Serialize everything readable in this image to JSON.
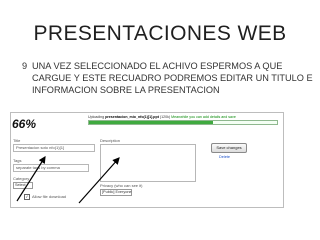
{
  "slide": {
    "title": "PRESENTACIONES WEB",
    "bullet_number": "9",
    "bullet_text": "UNA VEZ SELECCIONADO EL ACHIVO ESPERMOS A QUE CARGUE Y ESTE RECUADRO PODREMOS EDITAR UN TITULO E INFORMACION SOBRE LA PRESENTACION"
  },
  "screenshot": {
    "progress_label": "66%",
    "progress_fraction": 0.66,
    "upload_prefix": "Uploading",
    "upload_filename": "presentacion_mio_nfo(1)[1].ppt",
    "upload_meta": "(120k)",
    "upload_hint": "Meanwhile you can add details and save",
    "title_label": "Title",
    "title_value": "Presentacion soto nfo(1)[1]",
    "description_label": "Description",
    "tags_label": "Tags",
    "tags_placeholder": "separate tags by comma",
    "category_label": "Category",
    "category_value": "Select",
    "privacy_label": "Privacy (who can see it)",
    "privacy_value": "[Public] Everyone",
    "download_label": "Allow file download",
    "save_button": "Save changes",
    "delete_link": "Delete"
  }
}
